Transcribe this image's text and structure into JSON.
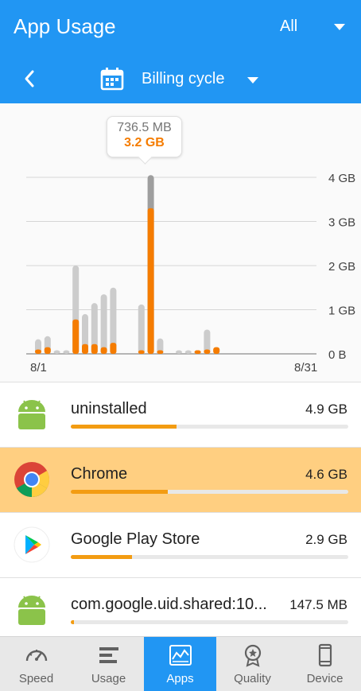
{
  "header": {
    "title": "App Usage",
    "filter_label": "All",
    "billing_label": "Billing cycle"
  },
  "tooltip": {
    "mobile_value": "736.5 MB",
    "wifi_value": "3.2 GB"
  },
  "chart_data": {
    "type": "bar",
    "x_start_label": "8/1",
    "x_end_label": "8/31",
    "y_tick_labels": [
      "0 B",
      "1 GB",
      "2 GB",
      "3 GB",
      "4 GB"
    ],
    "ylim": [
      0,
      4
    ],
    "y_unit": "GB",
    "days": [
      1,
      2,
      3,
      4,
      5,
      6,
      7,
      8,
      9,
      10,
      11,
      12,
      13,
      14,
      15,
      16,
      17,
      18,
      19,
      20,
      21,
      22,
      23,
      24,
      25,
      26,
      27,
      28,
      29,
      30,
      31
    ],
    "series": [
      {
        "values": [
          0.33,
          0.4,
          0.08,
          0.08,
          2.0,
          0.9,
          1.15,
          1.35,
          1.5,
          0,
          0,
          1.12,
          4.05,
          0.35,
          0,
          0.08,
          0.08,
          0.08,
          0.55,
          0.15,
          0,
          0,
          0,
          0,
          0,
          0,
          0,
          0,
          0,
          0,
          0
        ],
        "color": "#cccccc"
      },
      {
        "values": [
          0.1,
          0.15,
          0,
          0,
          0.78,
          0.22,
          0.22,
          0.15,
          0.25,
          0,
          0,
          0.08,
          3.3,
          0.08,
          0,
          0,
          0,
          0.08,
          0.1,
          0.15,
          0,
          0,
          0,
          0,
          0,
          0,
          0,
          0,
          0,
          0,
          0
        ],
        "color": "#f57c00"
      }
    ],
    "highlight_day": 13,
    "highlight_color": "#9e9e9e",
    "grid": true
  },
  "apps": [
    {
      "name": "uninstalled",
      "size": "4.9 GB",
      "fraction": 0.38,
      "icon": "android-icon"
    },
    {
      "name": "Chrome",
      "size": "4.6 GB",
      "fraction": 0.35,
      "icon": "chrome-icon"
    },
    {
      "name": "Google Play Store",
      "size": "2.9 GB",
      "fraction": 0.22,
      "icon": "play-store-icon"
    },
    {
      "name": "com.google.uid.shared:10...",
      "size": "147.5 MB",
      "fraction": 0.012,
      "icon": "android-icon"
    }
  ],
  "nav": [
    {
      "label": "Speed",
      "icon": "speedometer-icon"
    },
    {
      "label": "Usage",
      "icon": "usage-list-icon"
    },
    {
      "label": "Apps",
      "icon": "apps-chart-icon"
    },
    {
      "label": "Quality",
      "icon": "quality-badge-icon"
    },
    {
      "label": "Device",
      "icon": "device-icon"
    }
  ],
  "colors": {
    "primary": "#2196f3",
    "accent": "#f57c00",
    "selected_row": "#ffcf81",
    "progress": "#f39c12"
  }
}
